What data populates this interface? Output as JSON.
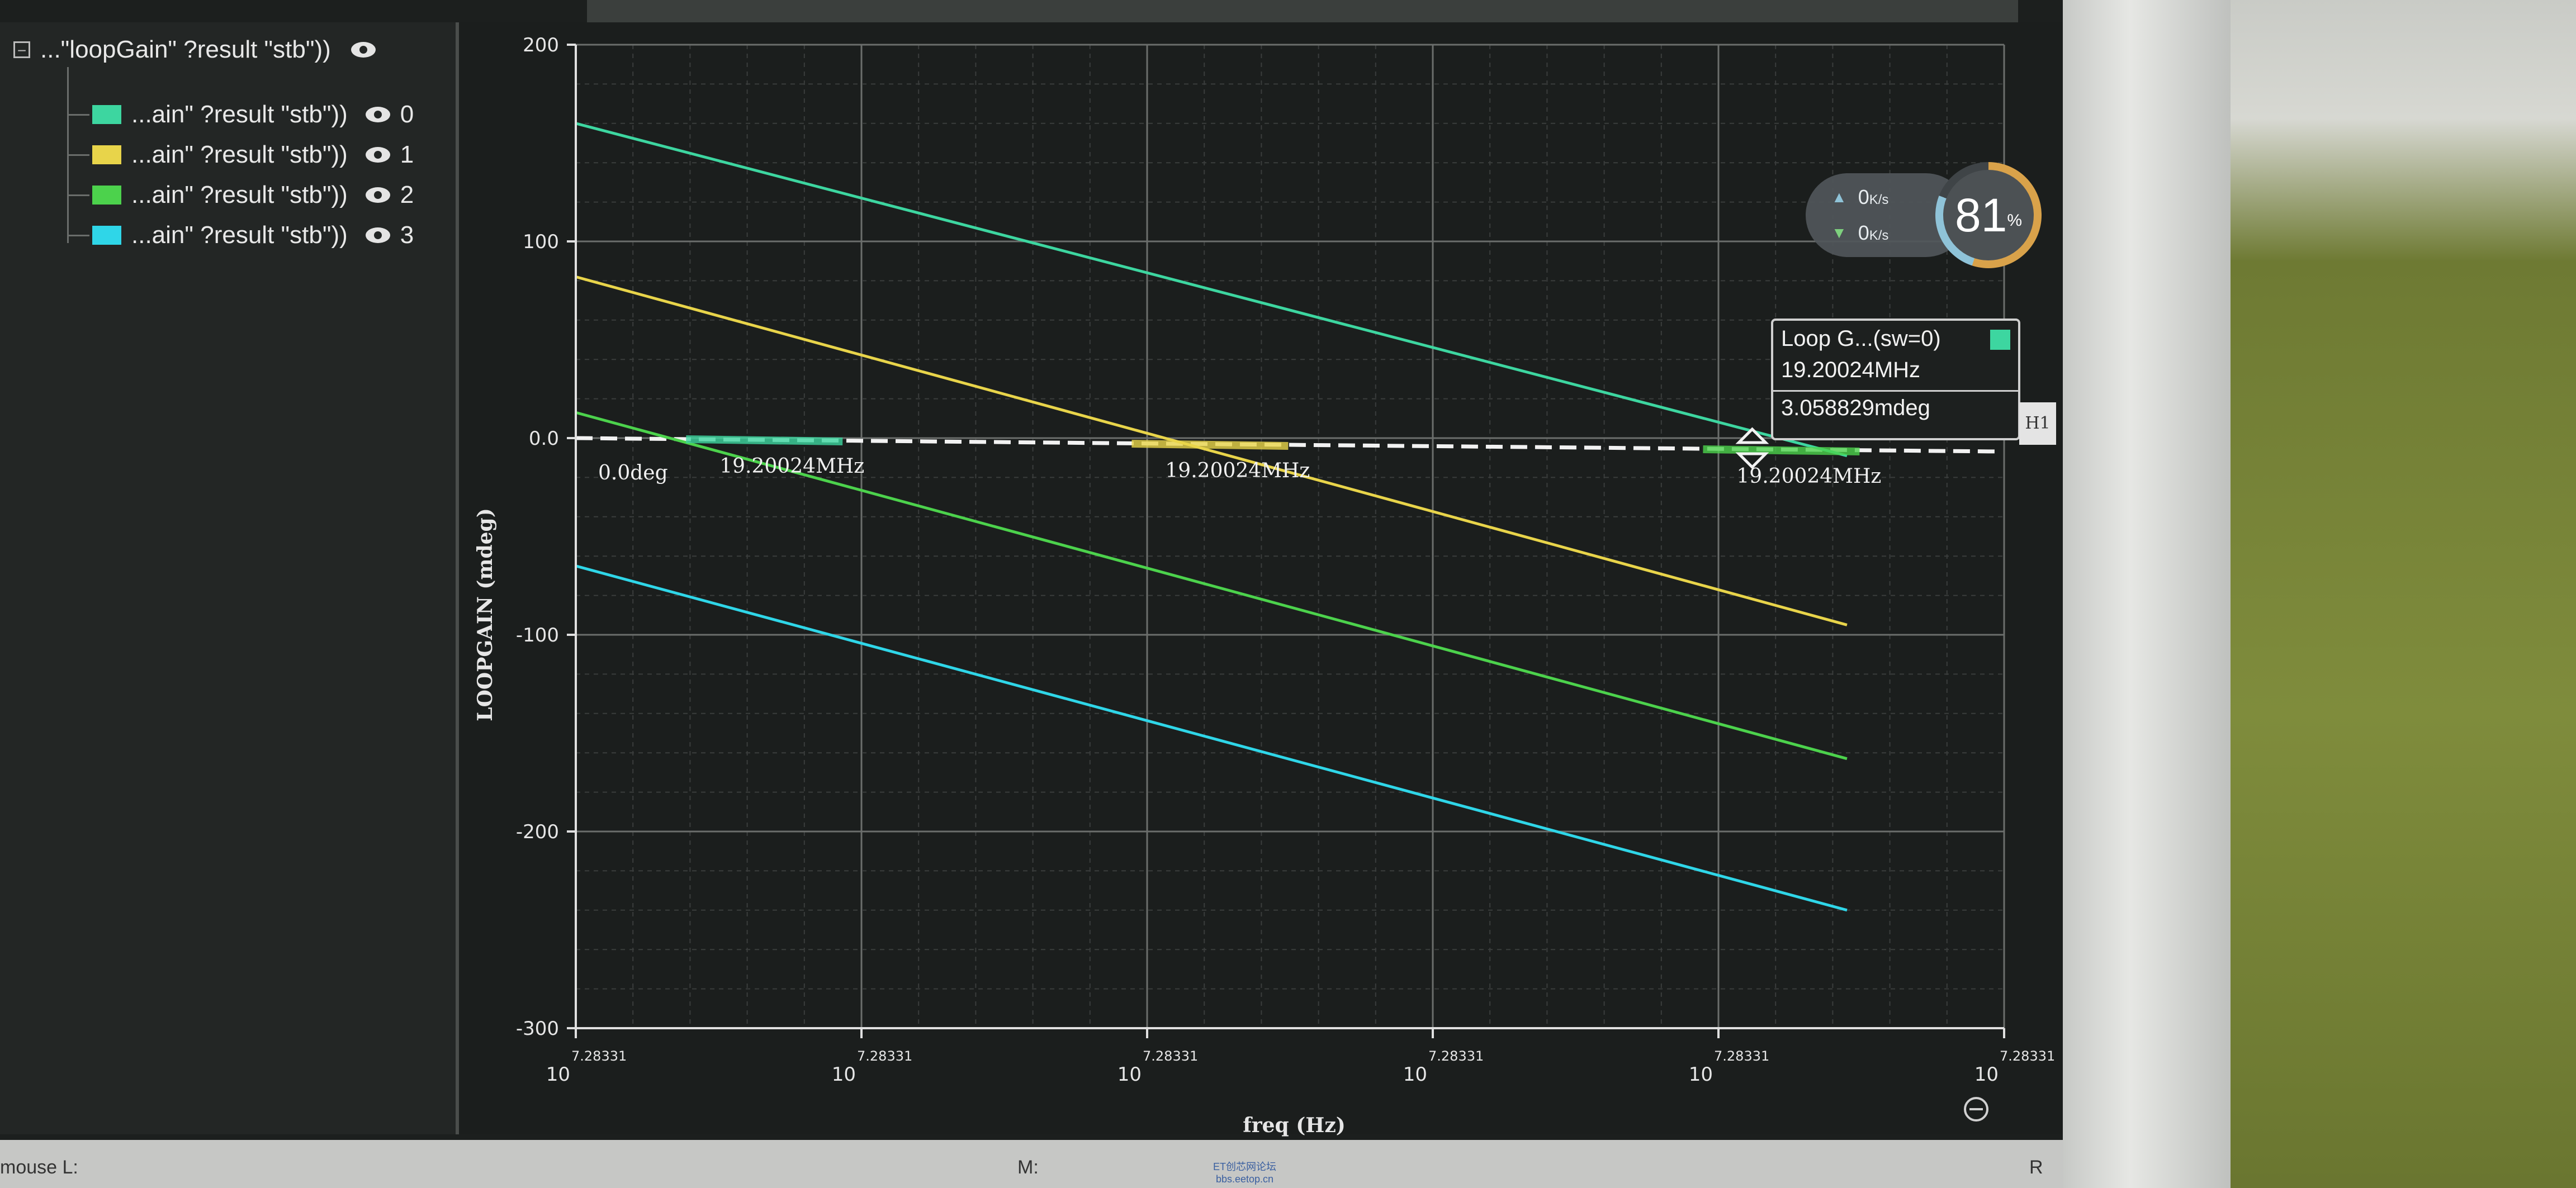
{
  "legend": {
    "root_label": "...\"loopGain\" ?result \"stb\"))",
    "items": [
      {
        "label": "...ain\" ?result \"stb\"))",
        "index": "0",
        "color": "#3dd6a0"
      },
      {
        "label": "...ain\" ?result \"stb\"))",
        "index": "1",
        "color": "#e8d44a"
      },
      {
        "label": "...ain\" ?result \"stb\"))",
        "index": "2",
        "color": "#4cd24c"
      },
      {
        "label": "...ain\" ?result \"stb\"))",
        "index": "3",
        "color": "#2fd6e8"
      }
    ]
  },
  "chart_data": {
    "type": "line",
    "xlabel": "freq (Hz)",
    "ylabel": "LOOPGAIN (mdeg)",
    "x_tick_labels": [
      "10",
      "10",
      "10",
      "10",
      "10",
      "10"
    ],
    "x_tick_exponent": "7.28331",
    "y_ticks": [
      200,
      100,
      0,
      -100,
      -200,
      -300
    ],
    "y_tick_labels": [
      "200",
      "100",
      "0.0",
      "-100",
      "-200",
      "-300"
    ],
    "ylim": [
      -300,
      200
    ],
    "xlim": [
      0,
      5
    ],
    "grid": true,
    "series": [
      {
        "name": "0",
        "color": "#3dd6a0",
        "x": [
          0,
          4.45
        ],
        "y": [
          160,
          -9
        ]
      },
      {
        "name": "1",
        "color": "#e8d44a",
        "x": [
          0,
          4.45
        ],
        "y": [
          82,
          -95
        ]
      },
      {
        "name": "2",
        "color": "#4cd24c",
        "x": [
          0,
          4.45
        ],
        "y": [
          13,
          -163
        ]
      },
      {
        "name": "3",
        "color": "#2fd6e8",
        "x": [
          0,
          4.45
        ],
        "y": [
          -65,
          -240
        ]
      }
    ],
    "hline": {
      "y": 0,
      "label": "0.0deg"
    },
    "markers": [
      {
        "x": 0.66,
        "label": "19.20024MHz"
      },
      {
        "x": 2.22,
        "label": "19.20024MHz"
      },
      {
        "x": 4.22,
        "label": "19.20024MHz"
      }
    ]
  },
  "tooltip": {
    "title": "Loop G...(sw=0)",
    "freq": "19.20024MHz",
    "value": "3.058829mdeg",
    "swatch_color": "#3dd6a0"
  },
  "h1_label": "H1",
  "status": {
    "left": "mouse L:",
    "middle": "M:",
    "right": "R"
  },
  "speed": {
    "up": "0",
    "up_unit": "K/s",
    "down": "0",
    "down_unit": "K/s",
    "percent": "81",
    "pct_sign": "%"
  },
  "watermark": {
    "line1": "ET创芯网论坛",
    "line2": "bbs.eetop.cn"
  }
}
